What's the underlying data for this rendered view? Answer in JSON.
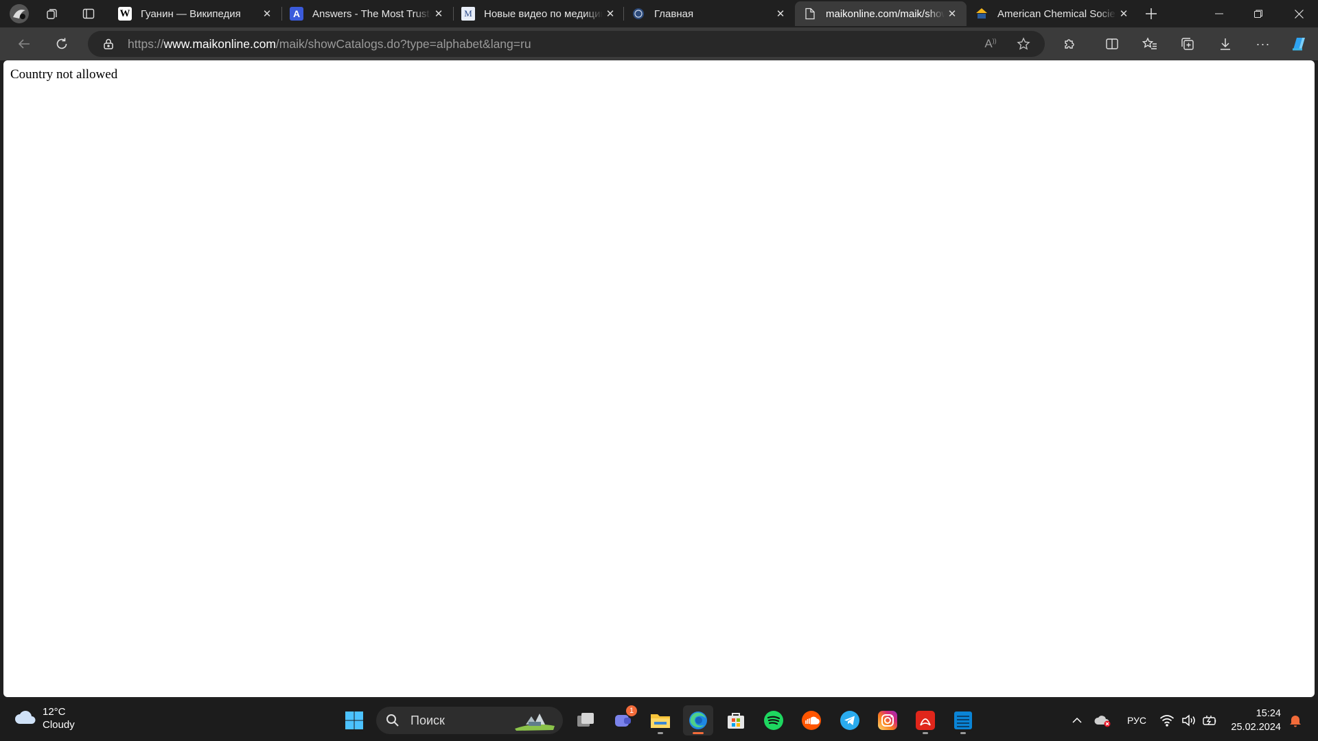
{
  "browser": {
    "tabs": [
      {
        "title": "Гуанин — Википедия",
        "favicon": "wikipedia-icon",
        "active": false
      },
      {
        "title": "Answers - The Most Trusted",
        "favicon": "answers-icon",
        "active": false
      },
      {
        "title": "Новые видео по медицине",
        "favicon": "medpub-icon",
        "active": false
      },
      {
        "title": "Главная",
        "favicon": "site-logo-icon",
        "active": false
      },
      {
        "title": "maikonline.com/maik/showCatalogs",
        "favicon": "page-icon",
        "active": true
      },
      {
        "title": "American Chemical Society",
        "favicon": "acs-icon",
        "active": false
      }
    ],
    "address_bar": {
      "url_prefix": "https://",
      "url_host": "www.maikonline.com",
      "url_path": "/maik/showCatalogs.do?type=alphabet&lang=ru"
    }
  },
  "page": {
    "message": "Country not allowed"
  },
  "taskbar": {
    "weather": {
      "temperature": "12°C",
      "condition": "Cloudy"
    },
    "search_placeholder": "Поиск",
    "teams_badge": "1",
    "language": "РУС",
    "time": "15:24",
    "date": "25.02.2024"
  },
  "colors": {
    "chrome_bg": "#202020",
    "toolbar_bg": "#3b3b3b",
    "edge_accent": "#f26b3a"
  }
}
